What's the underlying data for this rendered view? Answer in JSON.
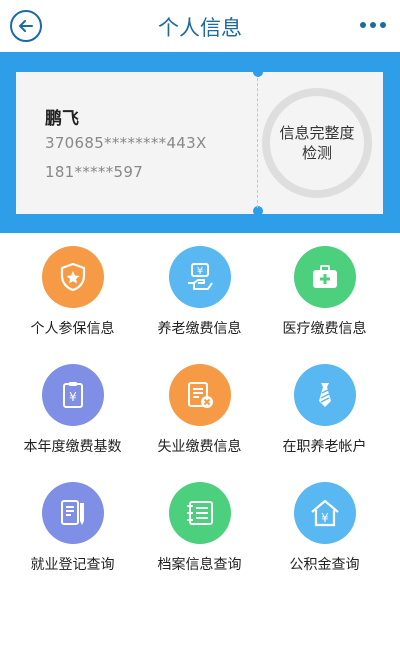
{
  "header": {
    "title": "个人信息",
    "back_icon": "back-arrow-icon",
    "more_icon": "more-dots-icon"
  },
  "card": {
    "name": "鹏飞",
    "id_number": "370685********443X",
    "phone": "181*****597",
    "check_label": "信息完整度检测"
  },
  "colors": {
    "accent": "#2f9ee8",
    "header_text": "#1d6a9e"
  },
  "grid": [
    {
      "label": "个人参保信息",
      "icon": "shield-star-icon",
      "color": "#f79a46"
    },
    {
      "label": "养老缴费信息",
      "icon": "hand-coin-icon",
      "color": "#59b8f2"
    },
    {
      "label": "医疗缴费信息",
      "icon": "medical-kit-icon",
      "color": "#4cd07e"
    },
    {
      "label": "本年度缴费基数",
      "icon": "clipboard-yuan-icon",
      "color": "#7f8fe6"
    },
    {
      "label": "失业缴费信息",
      "icon": "document-cancel-icon",
      "color": "#f79a46"
    },
    {
      "label": "在职养老帐户",
      "icon": "tie-icon",
      "color": "#59b8f2"
    },
    {
      "label": "就业登记查询",
      "icon": "document-pen-icon",
      "color": "#7f8fe6"
    },
    {
      "label": "档案信息查询",
      "icon": "archive-list-icon",
      "color": "#4cd07e"
    },
    {
      "label": "公积金查询",
      "icon": "house-yuan-icon",
      "color": "#59b8f2"
    }
  ]
}
